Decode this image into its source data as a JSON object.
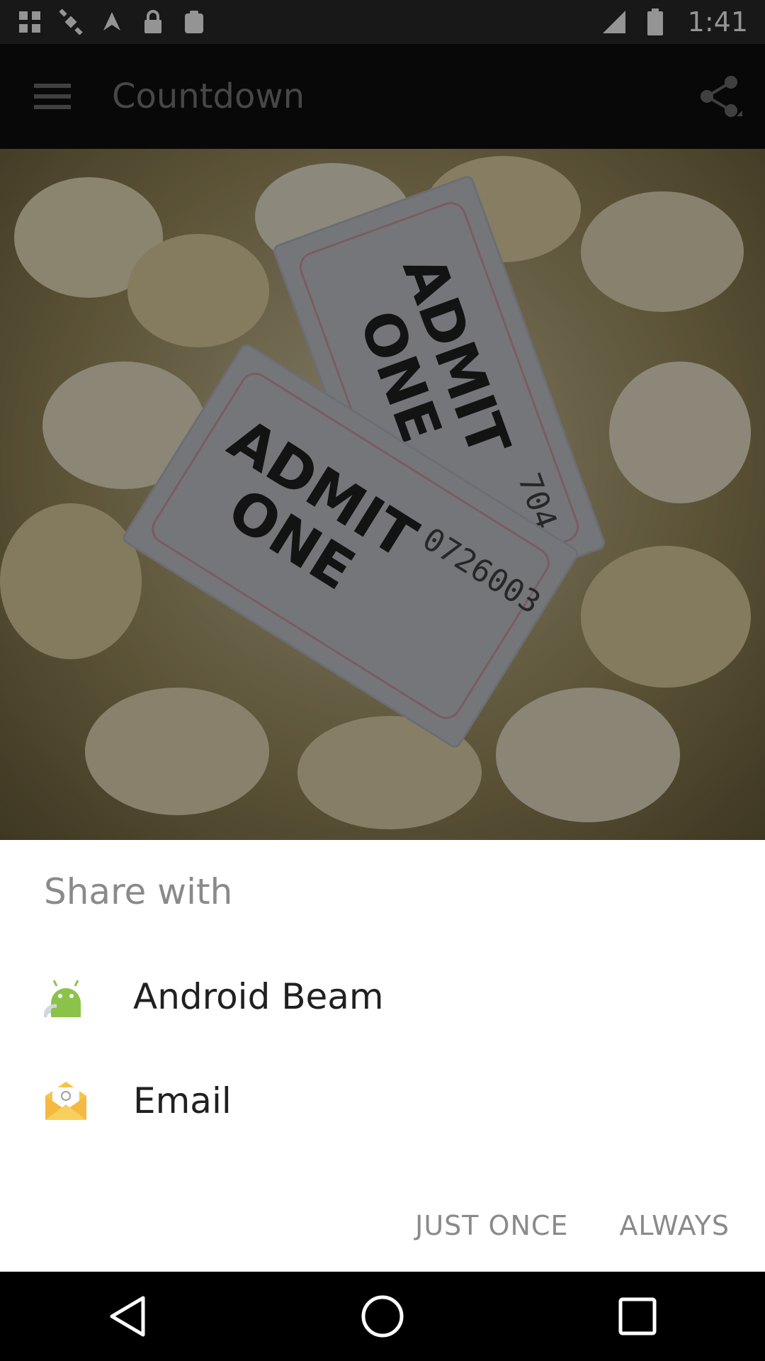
{
  "status_bar": {
    "time": "1:41",
    "icons_left": [
      "menu-grid-icon",
      "satellite-icon",
      "fake-gps-icon",
      "lock-icon",
      "clipboard-icon"
    ],
    "icons_right": [
      "signal-icon",
      "battery-icon"
    ]
  },
  "app_bar": {
    "title": "Countdown",
    "menu_icon": "hamburger-menu-icon",
    "share_icon": "share-icon"
  },
  "hero": {
    "ticket_back_text_line1": "ADMIT",
    "ticket_back_text_line2": "ONE",
    "ticket_back_number": "704",
    "ticket_front_text_line1": "ADMIT",
    "ticket_front_text_line2": "ONE",
    "ticket_front_number": "0726003"
  },
  "share_sheet": {
    "title": "Share with",
    "items": [
      {
        "label": "Android Beam",
        "icon": "android-beam-icon"
      },
      {
        "label": "Email",
        "icon": "email-icon"
      }
    ],
    "buttons": {
      "just_once": "JUST ONCE",
      "always": "ALWAYS"
    }
  },
  "nav_bar": {
    "back": "back-icon",
    "home": "home-icon",
    "recents": "recents-icon"
  }
}
